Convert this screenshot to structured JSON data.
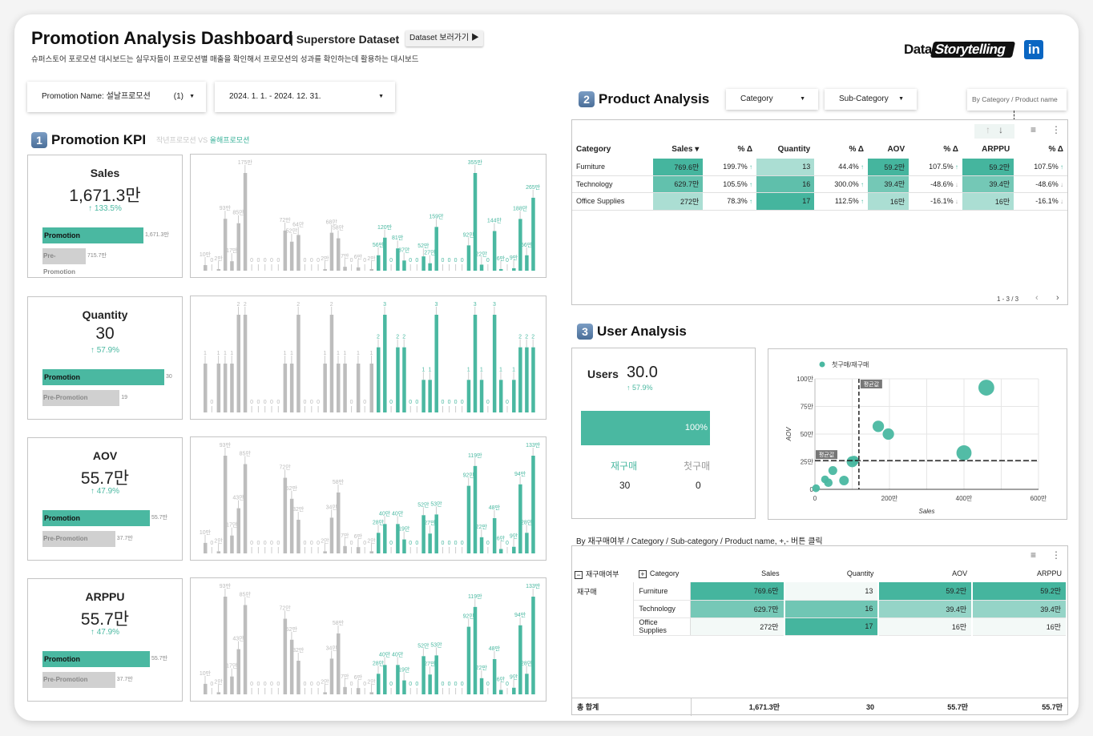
{
  "header": {
    "title": "Promotion Analysis Dashboard",
    "subtitle": "| Superstore Dataset",
    "dataset_button": "Dataset 보러가기 ▶",
    "description": "슈퍼스토어 포로모션 대시보드는 실무자들이 프로모션별 매출을 확인해서 프로모션의 성과를 확인하는데 활용하는 대시보드",
    "logo_text_1": "Data",
    "logo_text_2": "Storytelling",
    "linkedin": "in"
  },
  "filters": {
    "promotion_label": "Promotion Name: 설날프로모션",
    "promotion_count": "(1)",
    "date_range": "2024. 1. 1. - 2024. 12. 31."
  },
  "kpi_section": {
    "badge": "1",
    "title": "Promotion KPI",
    "compare_prev": "작년프로모션 VS ",
    "compare_cur": "올해프로모션"
  },
  "kpis": [
    {
      "title": "Sales",
      "value": "1,671.3만",
      "delta": "↑ 133.5%",
      "promo_label": "Promotion",
      "promo_value": "1,671.3만",
      "promo_num": 1671.3,
      "pre_label": "Pre-Promotion",
      "pre_value": "715.7만",
      "pre_num": 715.7
    },
    {
      "title": "Quantity",
      "value": "30",
      "delta": "↑ 57.9%",
      "promo_label": "Promotion",
      "promo_value": "30",
      "promo_num": 30,
      "pre_label": "Pre-Promotion",
      "pre_value": "19",
      "pre_num": 19
    },
    {
      "title": "AOV",
      "value": "55.7만",
      "delta": "↑ 47.9%",
      "promo_label": "Promotion",
      "promo_value": "55.7만",
      "promo_num": 55.7,
      "pre_label": "Pre-Promotion",
      "pre_value": "37.7만",
      "pre_num": 37.7
    },
    {
      "title": "ARPPU",
      "value": "55.7만",
      "delta": "↑ 47.9%",
      "promo_label": "Promotion",
      "promo_value": "55.7만",
      "promo_num": 55.7,
      "pre_label": "Pre-Promotion",
      "pre_value": "37.7만",
      "pre_num": 37.7
    }
  ],
  "colors": {
    "accent": "#4ab8a1",
    "pre": "#bdbdbd",
    "badge": "#5b7fa6"
  },
  "chart_data": [
    {
      "type": "bar",
      "unit": "만",
      "series": [
        {
          "values": [
            10,
            0,
            2,
            93,
            17,
            85,
            175,
            0,
            0,
            0,
            0,
            0,
            72,
            52,
            64,
            0,
            0,
            0,
            2,
            68,
            58,
            7,
            0,
            6,
            0,
            2
          ]
        },
        {
          "values": [
            56,
            120,
            0,
            81,
            37,
            0,
            0,
            52,
            27,
            159,
            0,
            0,
            0,
            0,
            92,
            355,
            22,
            0,
            144,
            6,
            0,
            9,
            188,
            56,
            265
          ]
        }
      ]
    },
    {
      "type": "bar",
      "unit": "",
      "series": [
        {
          "values": [
            1,
            0,
            1,
            1,
            1,
            2,
            2,
            0,
            0,
            0,
            0,
            0,
            1,
            1,
            2,
            0,
            0,
            0,
            1,
            2,
            1,
            1,
            0,
            1,
            0,
            1
          ]
        },
        {
          "values": [
            2,
            3,
            0,
            2,
            2,
            0,
            0,
            1,
            1,
            3,
            0,
            0,
            0,
            0,
            1,
            3,
            1,
            0,
            3,
            1,
            0,
            1,
            2,
            2,
            2
          ]
        }
      ]
    },
    {
      "type": "bar",
      "unit": "만",
      "series": [
        {
          "values": [
            10,
            0,
            2,
            93,
            17,
            43,
            85,
            0,
            0,
            0,
            0,
            0,
            72,
            52,
            32,
            0,
            0,
            0,
            2,
            34,
            58,
            7,
            0,
            6,
            0,
            2
          ]
        },
        {
          "values": [
            28,
            40,
            0,
            40,
            19,
            0,
            0,
            52,
            27,
            53,
            0,
            0,
            0,
            0,
            92,
            119,
            22,
            0,
            48,
            6,
            0,
            9,
            94,
            28,
            133
          ]
        }
      ]
    },
    {
      "type": "bar",
      "unit": "만",
      "series": [
        {
          "values": [
            10,
            0,
            2,
            93,
            17,
            43,
            85,
            0,
            0,
            0,
            0,
            0,
            72,
            52,
            32,
            0,
            0,
            0,
            2,
            34,
            58,
            7,
            0,
            6,
            0,
            2
          ]
        },
        {
          "values": [
            28,
            40,
            0,
            40,
            19,
            0,
            0,
            52,
            27,
            53,
            0,
            0,
            0,
            0,
            92,
            119,
            22,
            0,
            48,
            6,
            0,
            9,
            94,
            28,
            133
          ]
        }
      ]
    },
    {
      "type": "scatter",
      "legend": "첫구매/재구매",
      "legend_position": "top-left",
      "xlabel": "Sales",
      "ylabel": "AOV",
      "xlim": [
        0,
        600
      ],
      "ylim": [
        0,
        100
      ],
      "xticks": [
        "0",
        "200만",
        "400만",
        "600만"
      ],
      "yticks": [
        "0",
        "25만",
        "50만",
        "75만",
        "100만"
      ],
      "mean_label": "평균값",
      "mean_x": 118,
      "mean_y": 26,
      "grid": true,
      "points": [
        {
          "x": 460,
          "y": 92,
          "size": 3
        },
        {
          "x": 400,
          "y": 33,
          "size": 2.8
        },
        {
          "x": 170,
          "y": 57,
          "size": 1.8
        },
        {
          "x": 197,
          "y": 50,
          "size": 1.8
        },
        {
          "x": 100,
          "y": 25,
          "size": 1.7
        },
        {
          "x": 105,
          "y": 26,
          "size": 1.3
        },
        {
          "x": 48,
          "y": 17,
          "size": 1.1
        },
        {
          "x": 78,
          "y": 8,
          "size": 1.3
        },
        {
          "x": 27,
          "y": 9,
          "size": 0.8
        },
        {
          "x": 36,
          "y": 6,
          "size": 1
        },
        {
          "x": 3,
          "y": 1,
          "size": 0.8
        }
      ]
    }
  ],
  "product": {
    "badge": "2",
    "title": "Product Analysis",
    "category_dd": "Category",
    "subcategory_dd": "Sub-Category",
    "view_button": "By Category / Product name",
    "columns": [
      "Category",
      "Sales ▾",
      "% Δ",
      "Quantity",
      "% Δ",
      "AOV",
      "% Δ",
      "ARPPU",
      "% Δ"
    ],
    "rows": [
      [
        "Furniture",
        "769.6만",
        "199.7%",
        "13",
        "44.4%",
        "59.2만",
        "107.5%",
        "59.2만",
        "107.5%"
      ],
      [
        "Technology",
        "629.7만",
        "105.5%",
        "16",
        "300.0%",
        "39.4만",
        "-48.6%",
        "39.4만",
        "-48.6%"
      ],
      [
        "Office Supplies",
        "272만",
        "78.3%",
        "17",
        "112.5%",
        "16만",
        "-16.1%",
        "16만",
        "-16.1%"
      ]
    ],
    "pagination": "1 - 3 / 3"
  },
  "users": {
    "badge": "3",
    "title": "User Analysis",
    "label": "Users",
    "value": "30.0",
    "delta": "↑ 57.9%",
    "bar_label": "100%",
    "bar_percent": 100,
    "repeat_label": "재구매",
    "repeat_value": "30",
    "first_label": "첫구매",
    "first_value": "0"
  },
  "detail": {
    "caption": "By 재구매여부 / Category / Sub-category / Product name, +,- 버튼 클릭",
    "col_group": "재구매여부",
    "col_category": "Category",
    "columns": [
      "Sales",
      "Quantity",
      "AOV",
      "ARPPU"
    ],
    "group": "재구매",
    "rows": [
      [
        "Furniture",
        "769.6만",
        "13",
        "59.2만",
        "59.2만"
      ],
      [
        "Technology",
        "629.7만",
        "16",
        "39.4만",
        "39.4만"
      ],
      [
        "Office Supplies",
        "272만",
        "17",
        "16만",
        "16만"
      ]
    ],
    "total_label": "총 합계",
    "totals": [
      "1,671.3만",
      "30",
      "55.7만",
      "55.7만"
    ]
  }
}
